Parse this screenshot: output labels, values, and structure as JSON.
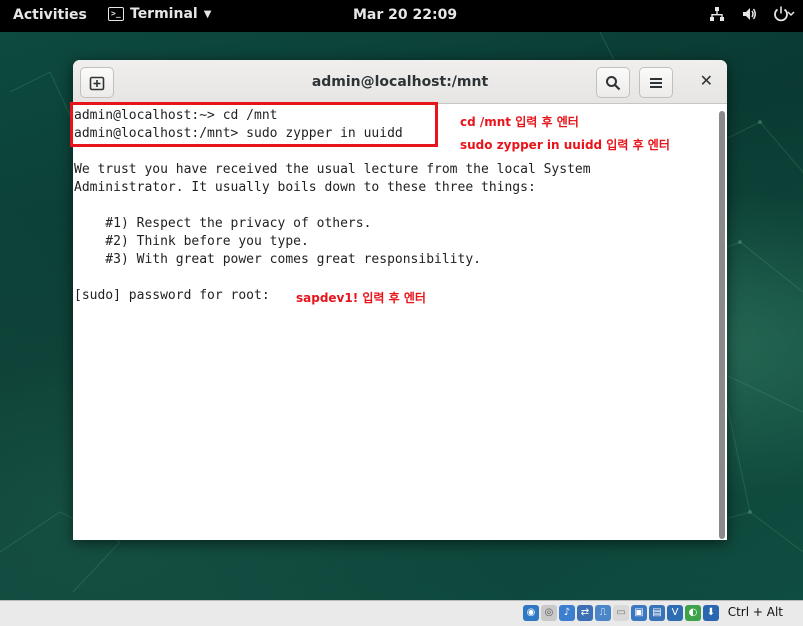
{
  "topbar": {
    "activities": "Activities",
    "app_name": "Terminal",
    "clock": "Mar 20  22:09"
  },
  "window": {
    "title": "admin@localhost:/mnt"
  },
  "terminal": {
    "lines": [
      "admin@localhost:~> cd /mnt",
      "admin@localhost:/mnt> sudo zypper in uuidd",
      "",
      "We trust you have received the usual lecture from the local System",
      "Administrator. It usually boils down to these three things:",
      "",
      "    #1) Respect the privacy of others.",
      "    #2) Think before you type.",
      "    #3) With great power comes great responsibility.",
      "",
      "[sudo] password for root:"
    ]
  },
  "annotations": {
    "cd": "cd /mnt 입력 후 엔터",
    "zypper": "sudo zypper in uuidd 입력 후 엔터",
    "password": "sapdev1! 입력 후 엔터"
  },
  "statusbar": {
    "hostkey": "Ctrl + Alt"
  },
  "icons": {
    "new_tab": "new-tab-icon",
    "search": "search-icon",
    "menu": "hamburger-menu-icon",
    "close": "close-icon",
    "network": "network-icon",
    "volume": "volume-icon",
    "power": "power-icon"
  },
  "colors": {
    "annotation": "#e8141b",
    "topbar": "#000000",
    "terminal_bg": "#ffffff"
  }
}
